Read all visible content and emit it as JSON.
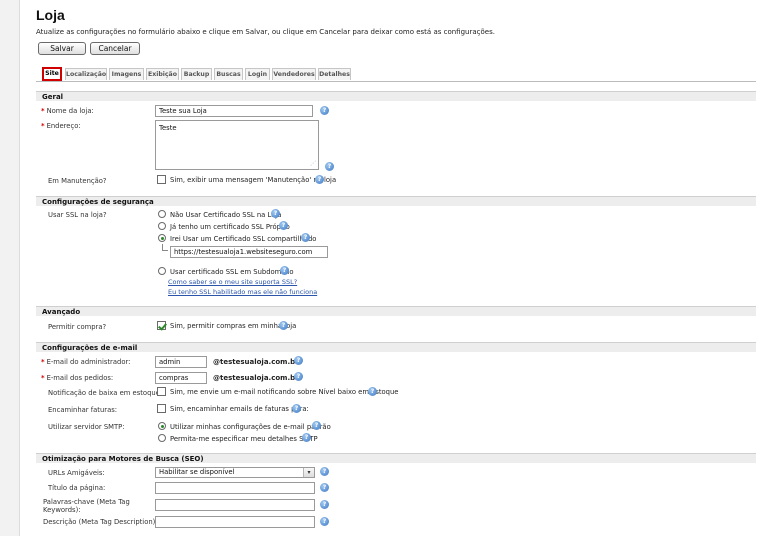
{
  "page": {
    "title": "Loja",
    "instructions": "Atualize as configurações no formulário abaixo e clique em Salvar, ou clique em Cancelar para deixar como está as configurações."
  },
  "toolbar": {
    "save_label": "Salvar",
    "cancel_label": "Cancelar"
  },
  "tabs": [
    {
      "label": "Site",
      "active": true
    },
    {
      "label": "Localização"
    },
    {
      "label": "Imagens"
    },
    {
      "label": "Exibição"
    },
    {
      "label": "Backup"
    },
    {
      "label": "Buscas"
    },
    {
      "label": "Login"
    },
    {
      "label": "Vendedores"
    },
    {
      "label": "Detalhes"
    }
  ],
  "geral": {
    "title": "Geral",
    "store_name_label": "Nome da loja:",
    "store_name_value": "Teste sua Loja",
    "address_label": "Endereço:",
    "address_value": "Teste",
    "maintenance_label": "Em Manutenção?",
    "maintenance_option": "Sim, exibir uma mensagem 'Manutenção' na loja",
    "maintenance_checked": false
  },
  "security": {
    "title": "Configurações de segurança",
    "ssl_label": "Usar SSL na loja?",
    "options": [
      {
        "label": "Não Usar Certificado SSL na Loja",
        "checked": false
      },
      {
        "label": "Já tenho um certificado SSL Próprio",
        "checked": false
      },
      {
        "label": "Irei Usar um Certificado SSL compartilhado",
        "checked": true
      },
      {
        "label": "Usar certificado SSL em Subdominio",
        "checked": false
      }
    ],
    "shared_url_value": "https://testesualoja1.websiteseguro.com",
    "link_check": "Como saber se o meu site suporta SSL?",
    "link_not_working": "Eu tenho SSL habilitado mas ele não funciona"
  },
  "advanced": {
    "title": "Avançado",
    "allow_purchase_label": "Permitir compra?",
    "allow_purchase_option": "Sim, permitir compras em minha loja",
    "allow_purchase_checked": true
  },
  "email": {
    "title": "Configurações de e-mail",
    "admin_label": "E-mail do administrador:",
    "admin_value": "admin",
    "orders_label": "E-mail dos pedidos:",
    "orders_value": "compras",
    "domain_suffix": "@testesualoja.com.br",
    "low_stock_label": "Notificação de baixa em estoque:",
    "low_stock_option": "Sim, me envie um e-mail notificando sobre Nível baixo em estoque",
    "invoices_label": "Encaminhar faturas:",
    "invoices_option": "Sim, encaminhar emails de faturas para:",
    "smtp_label": "Utilizar servidor SMTP:",
    "smtp_options": [
      {
        "label": "Utilizar minhas configurações de e-mail padrão",
        "checked": true
      },
      {
        "label": "Permita-me especificar meu detalhes SMTP",
        "checked": false
      }
    ]
  },
  "seo": {
    "title": "Otimização para Motores de Busca (SEO)",
    "urls_label": "URLs Amigáveis:",
    "urls_value": "Habilitar se disponível",
    "page_title_label": "Título da página:",
    "keywords_label": "Palavras-chave (Meta Tag Keywords):",
    "description_label": "Descrição (Meta Tag Description):"
  },
  "help_icon_glyph": "?"
}
